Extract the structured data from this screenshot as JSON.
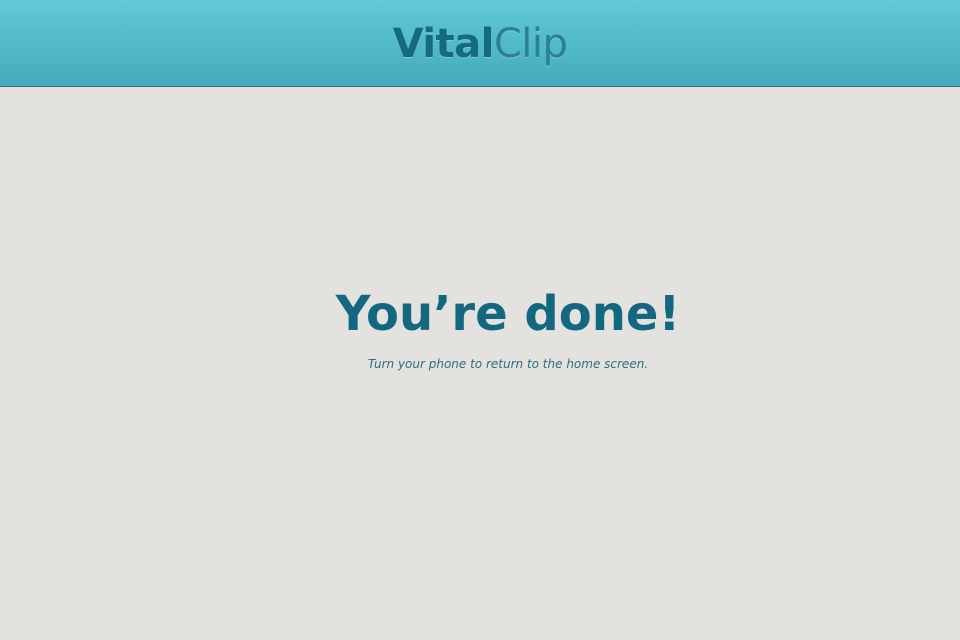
{
  "header": {
    "logo_bold": "Vital",
    "logo_light": "Clip"
  },
  "main": {
    "headline": "You’re done!",
    "instruction": "Turn your phone to return to the home screen."
  },
  "colors": {
    "header_top": "#62c9da",
    "header_bottom": "#45abbd",
    "background": "#e3e2de",
    "accent_text": "#136780"
  }
}
